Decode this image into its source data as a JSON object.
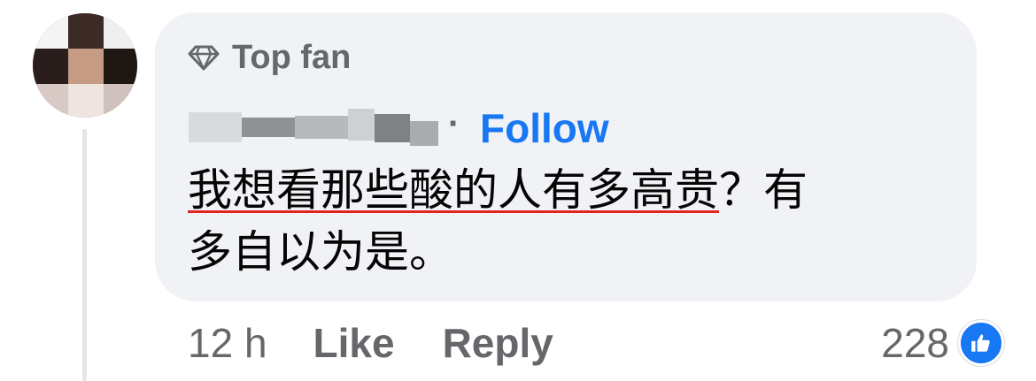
{
  "comment": {
    "badge_label": "Top fan",
    "separator": "·",
    "follow_label": "Follow",
    "text_line1_underlined": "我想看那些酸的人有多高贵",
    "text_line1_rest": "？有",
    "text_line2": "多自以为是。",
    "timestamp": "12 h",
    "like_label": "Like",
    "reply_label": "Reply",
    "reaction_count": "228"
  },
  "icons": {
    "badge": "diamond-icon",
    "reaction": "thumbs-up-icon"
  },
  "colors": {
    "bubble": "#f0f2f5",
    "link": "#1877f2",
    "secondary_text": "#65676b",
    "spellcheck_underline": "#e02424"
  }
}
